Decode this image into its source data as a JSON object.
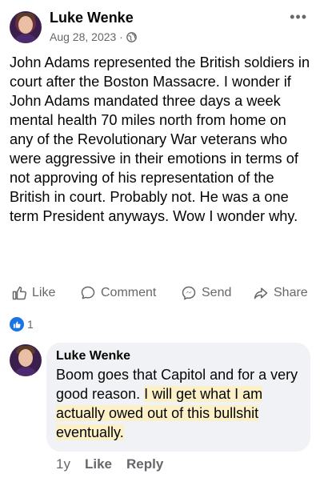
{
  "post": {
    "author": "Luke Wenke",
    "date": "Aug 28, 2023 ·",
    "audience_icon": "globe-icon",
    "text": "John Adams represented the British soldiers in court after the Boston Massacre.  I wonder if John Adams mandated three days a week mental health 70 miles north from home on any of the Revolutionary War veterans who were aggressive in their emotions in terms of not approving of his representation of the British in court. Probably not.  He was a one term President anyways.  Wow I wonder why."
  },
  "actions": {
    "like": "Like",
    "comment": "Comment",
    "send": "Send",
    "share": "Share"
  },
  "reactions": {
    "count": "1"
  },
  "comment": {
    "author": "Luke Wenke",
    "text_plain": "Boom goes that Capitol and for a very good reason. ",
    "text_highlighted": "I will get what I am actually owed out of this bullshit eventually.",
    "age": "1y",
    "like": "Like",
    "reply": "Reply"
  },
  "colors": {
    "accent": "#1b74e4",
    "highlight": "#fbf0c8",
    "bubble": "#f0f2f5",
    "muted": "#65676b"
  }
}
